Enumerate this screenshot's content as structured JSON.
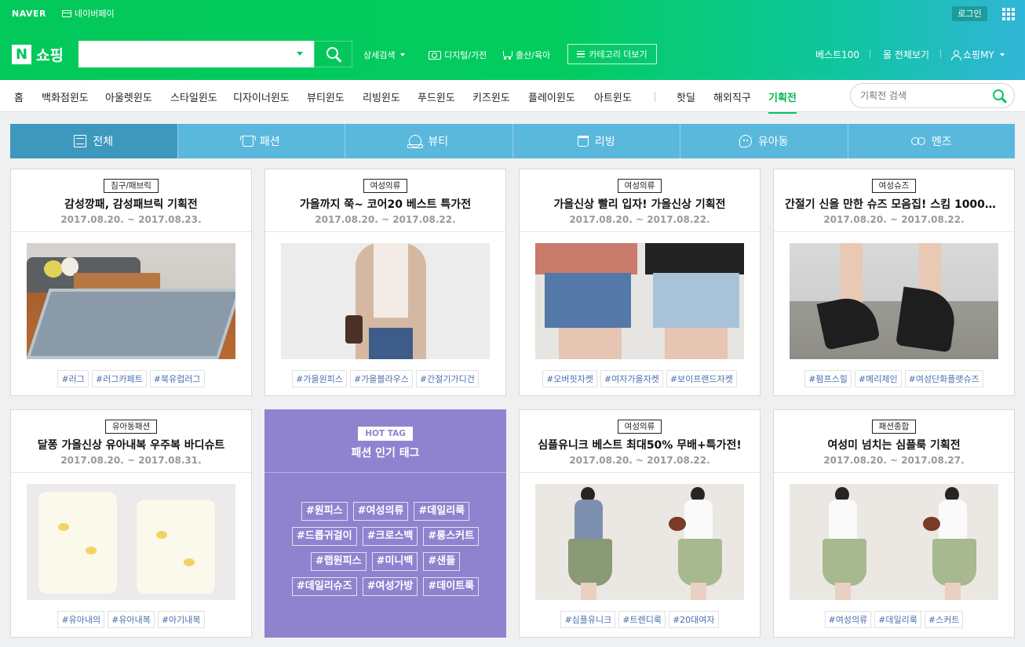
{
  "topbar": {
    "logo": "NAVER",
    "npay": "네이버페이",
    "login": "로그인"
  },
  "header": {
    "brand": "쇼핑",
    "search_placeholder": "",
    "detail_search": "상세검색",
    "digital": "디지털/가전",
    "baby": "출산/육아",
    "category_more": "카테고리 더보기",
    "best100": "베스트100",
    "all_malls": "몰 전체보기",
    "my_shopping": "쇼핑MY"
  },
  "catnav": {
    "items": [
      "홈",
      "백화점윈도",
      "아울렛윈도",
      "스타일윈도",
      "디자이너윈도",
      "뷰티윈도",
      "리빙윈도",
      "푸드윈도",
      "키즈윈도",
      "플레이윈도",
      "아트윈도"
    ],
    "extras": [
      "핫딜",
      "해외직구",
      "기획전"
    ],
    "active": "기획전",
    "search_placeholder": "기획전 검색"
  },
  "tabs": [
    {
      "label": "전체",
      "icon": "list-icon",
      "active": true
    },
    {
      "label": "패션",
      "icon": "shirt-icon",
      "active": false
    },
    {
      "label": "뷰티",
      "icon": "mirror-icon",
      "active": false
    },
    {
      "label": "리빙",
      "icon": "living-icon",
      "active": false
    },
    {
      "label": "유아동",
      "icon": "baby-icon",
      "active": false
    },
    {
      "label": "멘즈",
      "icon": "mens-icon",
      "active": false
    }
  ],
  "cards": [
    {
      "category": "침구/패브릭",
      "title": "감성깡패, 감성패브릭 기획전",
      "date": "2017.08.20. ~ 2017.08.23.",
      "tags": [
        "#러그",
        "#러그카페트",
        "#북유럽러그"
      ]
    },
    {
      "category": "여성의류",
      "title": "가을까지 쭉~ 코어20 베스트 특가전",
      "date": "2017.08.20. ~ 2017.08.22.",
      "tags": [
        "#가을원피스",
        "#가을블라우스",
        "#간절기가디건"
      ]
    },
    {
      "category": "여성의류",
      "title": "가을신상 빨리 입자! 가을신상 기획전",
      "date": "2017.08.20. ~ 2017.08.22.",
      "tags": [
        "#오버핏자켓",
        "#여자가을자켓",
        "#보이프랜드자켓"
      ]
    },
    {
      "category": "여성슈즈",
      "title": "간절기 신을 만한 슈즈 모음집! 스킴 1000원…",
      "date": "2017.08.20. ~ 2017.08.22.",
      "tags": [
        "#펌프스힐",
        "#메리제인",
        "#여성단화플랫슈즈"
      ]
    },
    {
      "category": "유아동패션",
      "title": "달퐁 가을신상 유아내복 우주복 바디슈트",
      "date": "2017.08.20. ~ 2017.08.31.",
      "tags": [
        "#유아내의",
        "#유아내복",
        "#아기내복"
      ]
    },
    {
      "category": "여성의류",
      "title": "심플유니크 베스트 최대50% 무배+특가전!",
      "date": "2017.08.20. ~ 2017.08.22.",
      "tags": [
        "#심플유니크",
        "#트렌디룩",
        "#20대여자"
      ]
    },
    {
      "category": "패션종합",
      "title": "여성미 넘치는 심플룩 기획전",
      "date": "2017.08.20. ~ 2017.08.27.",
      "tags": [
        "#여성의류",
        "#데일리룩",
        "#스커트"
      ]
    }
  ],
  "hot": {
    "badge": "HOT TAG",
    "title": "패션 인기 태그",
    "rows": [
      [
        "#원피스",
        "#여성의류",
        "#데일리룩"
      ],
      [
        "#드롭귀걸이",
        "#크로스백",
        "#롱스커트"
      ],
      [
        "#랩원피스",
        "#미니백",
        "#샌들"
      ],
      [
        "#데일리슈즈",
        "#여성가방",
        "#데이트룩"
      ]
    ]
  },
  "colors": {
    "brand": "#03c75a",
    "tab": "#5ab8dc",
    "tab_active": "#3e98bd",
    "hot": "#8f83cf"
  }
}
